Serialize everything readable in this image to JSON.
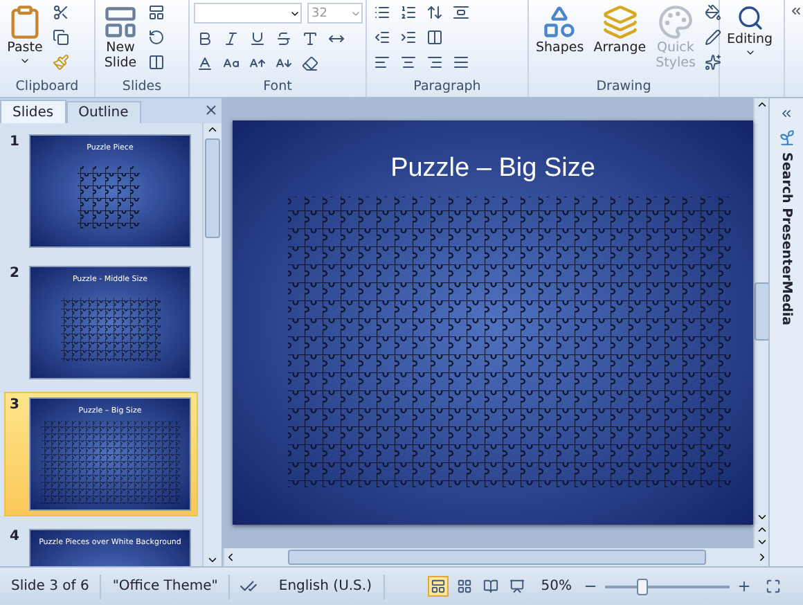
{
  "ribbon": {
    "groups": [
      {
        "kind": "clipboard",
        "label": "Clipboard",
        "big": {
          "label": "Paste"
        }
      },
      {
        "kind": "slides",
        "label": "Slides",
        "big": {
          "label": "New Slide"
        }
      },
      {
        "kind": "font",
        "label": "Font",
        "font_size": "32"
      },
      {
        "kind": "paragraph",
        "label": "Paragraph"
      },
      {
        "kind": "drawing",
        "label": "Drawing",
        "buttons": [
          {
            "label": "Shapes",
            "disabled": false
          },
          {
            "label": "Arrange",
            "disabled": false
          },
          {
            "label": "Quick Styles",
            "disabled": true
          }
        ]
      },
      {
        "kind": "editing",
        "label": "Editing"
      }
    ]
  },
  "panel": {
    "tabs": [
      {
        "label": "Slides",
        "selected": true
      },
      {
        "label": "Outline",
        "selected": false
      }
    ],
    "slides": [
      {
        "number": "1",
        "title": "Puzzle Piece",
        "selected": false,
        "kind": "piece"
      },
      {
        "number": "2",
        "title": "Puzzle - Middle Size",
        "selected": false,
        "kind": "middle"
      },
      {
        "number": "3",
        "title": "Puzzle – Big Size",
        "selected": true,
        "kind": "big"
      },
      {
        "number": "4",
        "title": "Puzzle Pieces over White Background",
        "selected": false,
        "kind": "white"
      }
    ]
  },
  "slide": {
    "title": "Puzzle – Big Size"
  },
  "side_pane": {
    "title": "Search PresenterMedia"
  },
  "status_bar": {
    "slide": "Slide 3 of 6",
    "theme": "\"Office Theme\"",
    "language": "English (U.S.)",
    "views": [
      {
        "kind": "normal",
        "selected": true
      },
      {
        "kind": "sorter",
        "selected": false
      },
      {
        "kind": "reading",
        "selected": false
      },
      {
        "kind": "show",
        "selected": false
      }
    ],
    "zoom": "50%",
    "zoom_level": {
      "level": 0.3
    }
  }
}
